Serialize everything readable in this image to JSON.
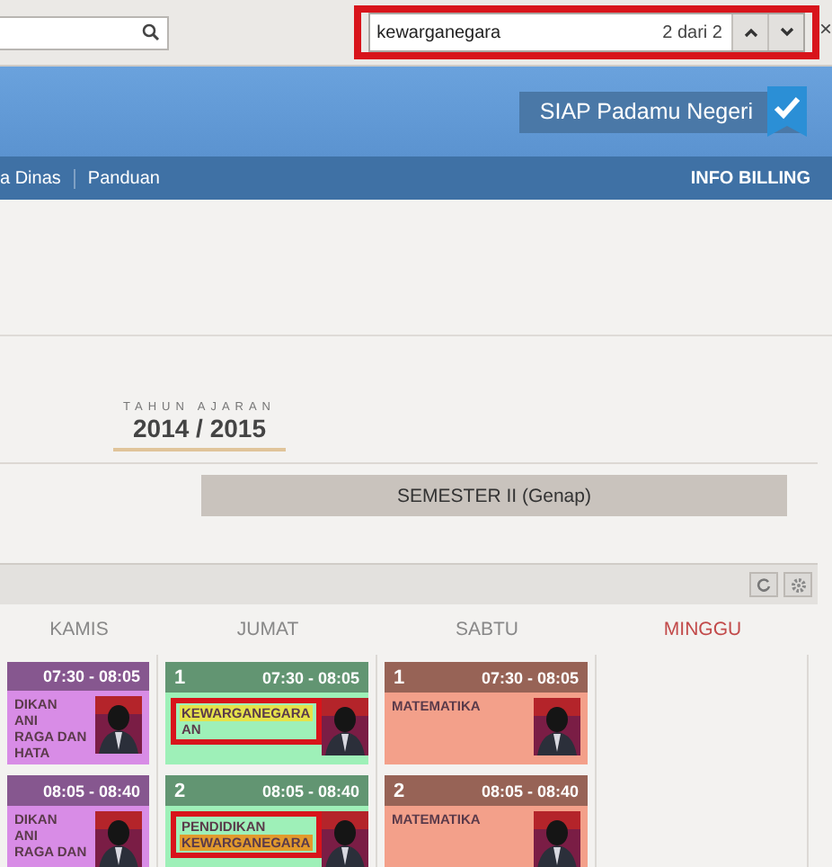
{
  "find_bar": {
    "query": "kewarganegara",
    "count": "2 dari 2",
    "annotated": true,
    "close": "×"
  },
  "header": {
    "brand_button": "SIAP Padamu Negeri"
  },
  "nav": {
    "items": [
      {
        "label": "a Dinas"
      },
      {
        "label": "Panduan"
      }
    ],
    "right": "INFO BILLING"
  },
  "year": {
    "label": "TAHUN AJARAN",
    "value": "2014 / 2015"
  },
  "semester": {
    "label": "SEMESTER II (Genap)"
  },
  "schedule": {
    "days": [
      {
        "name": "KAMIS",
        "holiday": false,
        "color": "#d88ce6",
        "entries": [
          {
            "time": "07:30 - 08:05",
            "annotated": false,
            "lines": [
              {
                "text": "DIKAN",
                "highlighted": false,
                "current": false
              },
              {
                "text": "ANI",
                "highlighted": false,
                "current": false
              },
              {
                "text": "RAGA DAN",
                "highlighted": false,
                "current": false
              },
              {
                "text": "HATA",
                "highlighted": false,
                "current": false
              }
            ]
          },
          {
            "time": "08:05 - 08:40",
            "annotated": false,
            "lines": [
              {
                "text": "DIKAN",
                "highlighted": false,
                "current": false
              },
              {
                "text": "ANI",
                "highlighted": false,
                "current": false
              },
              {
                "text": "RAGA DAN",
                "highlighted": false,
                "current": false
              }
            ]
          }
        ]
      },
      {
        "name": "JUMAT",
        "holiday": false,
        "color": "#9ef0b8",
        "entries": [
          {
            "number": "1",
            "time": "07:30 - 08:05",
            "annotated": true,
            "lines": [
              {
                "text": "KEWARGANEGARA",
                "highlighted": true,
                "current": false
              },
              {
                "text": "AN",
                "highlighted": false,
                "current": false
              }
            ]
          },
          {
            "number": "2",
            "time": "08:05 - 08:40",
            "annotated": true,
            "lines": [
              {
                "text": "PENDIDIKAN",
                "highlighted": false,
                "current": false
              },
              {
                "text": "KEWARGANEGARA",
                "highlighted": true,
                "current": true
              }
            ]
          }
        ]
      },
      {
        "name": "SABTU",
        "holiday": false,
        "color": "#f3a08a",
        "entries": [
          {
            "number": "1",
            "time": "07:30 - 08:05",
            "annotated": false,
            "lines": [
              {
                "text": "MATEMATIKA",
                "highlighted": false,
                "current": false
              }
            ]
          },
          {
            "number": "2",
            "time": "08:05 - 08:40",
            "annotated": false,
            "lines": [
              {
                "text": "MATEMATIKA",
                "highlighted": false,
                "current": false
              }
            ]
          }
        ]
      },
      {
        "name": "MINGGU",
        "holiday": true
      }
    ]
  }
}
